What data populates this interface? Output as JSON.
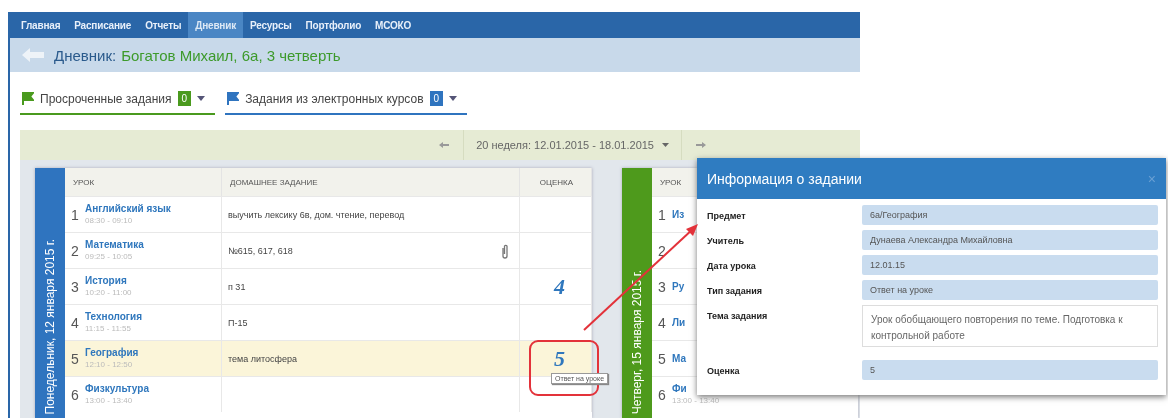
{
  "nav": {
    "items": [
      {
        "label": "Главная",
        "selected": false
      },
      {
        "label": "Расписание",
        "selected": false
      },
      {
        "label": "Отчеты",
        "selected": false
      },
      {
        "label": "Дневник",
        "selected": true
      },
      {
        "label": "Ресурсы",
        "selected": false
      },
      {
        "label": "Портфолио",
        "selected": false
      },
      {
        "label": "МСОКО",
        "selected": false
      }
    ]
  },
  "header": {
    "prefix": "Дневник:",
    "student": "Богатов Михаил, 6а, 3 четверть"
  },
  "filters": [
    {
      "label": "Просроченные задания",
      "count": "0",
      "color": "#4a9a1e"
    },
    {
      "label": "Задания из электронных курсов",
      "count": "0",
      "color": "#2f74bf"
    }
  ],
  "week": {
    "label": "20 неделя: 12.01.2015 - 18.01.2015"
  },
  "days": [
    {
      "title": "Понедельник, 12 января 2015 г.",
      "color": "#2f74bf",
      "columns": [
        "УРОК",
        "ДОМАШНЕЕ ЗАДАНИЕ",
        "ОЦЕНКА"
      ],
      "lessons": [
        {
          "number": "1",
          "subject": "Английский язык",
          "time": "08:30 - 09:10",
          "homework": "выучить лексику 6в, дом. чтение, перевод",
          "attachment": false,
          "selected": false
        },
        {
          "number": "2",
          "subject": "Математика",
          "time": "09:25 - 10:05",
          "homework": "№615, 617, 618",
          "attachment": true,
          "selected": false
        },
        {
          "number": "3",
          "subject": "История",
          "time": "10:20 - 11:00",
          "homework": "п 31",
          "grade": "4",
          "attachment": false,
          "selected": false
        },
        {
          "number": "4",
          "subject": "Технология",
          "time": "11:15 - 11:55",
          "homework": "П-15",
          "attachment": false,
          "selected": false
        },
        {
          "number": "5",
          "subject": "География",
          "time": "12:10 - 12:50",
          "homework": "тема литосфера",
          "grade": "5",
          "attachment": false,
          "selected": true
        },
        {
          "number": "6",
          "subject": "Физкультура",
          "time": "13:00 - 13:40",
          "attachment": false,
          "selected": false
        }
      ]
    },
    {
      "title": "Четверг, 15 января 2015 г.",
      "color": "#4e9a1c",
      "columns": [
        "УРОК"
      ],
      "lessons": [
        {
          "number": "1",
          "subject": "Из",
          "selected": false
        },
        {
          "number": "2",
          "selected": false
        },
        {
          "number": "3",
          "subject": "Ру",
          "selected": false
        },
        {
          "number": "4",
          "subject": "Ли",
          "selected": false
        },
        {
          "number": "5",
          "subject": "Ма",
          "selected": false
        },
        {
          "number": "6",
          "subject": "Фи",
          "time": "13:00 - 13:40",
          "selected": false
        }
      ]
    }
  ],
  "tooltip": "Ответ на уроке",
  "modal": {
    "title": "Информация о задании",
    "close": "×",
    "fields": [
      {
        "kind": "field",
        "label": "Предмет",
        "value": "6а/География"
      },
      {
        "kind": "field",
        "label": "Учитель",
        "value": "Дунаева Александра Михайловна"
      },
      {
        "kind": "field",
        "label": "Дата урока",
        "value": "12.01.15"
      },
      {
        "kind": "field",
        "label": "Тип задания",
        "value": "Ответ на уроке"
      },
      {
        "kind": "textarea",
        "label": "Тема задания",
        "value": "Урок обобщающего повторения по теме. Подготовка к контрольной работе"
      },
      {
        "kind": "field",
        "label": "Оценка",
        "value": "5"
      }
    ]
  }
}
